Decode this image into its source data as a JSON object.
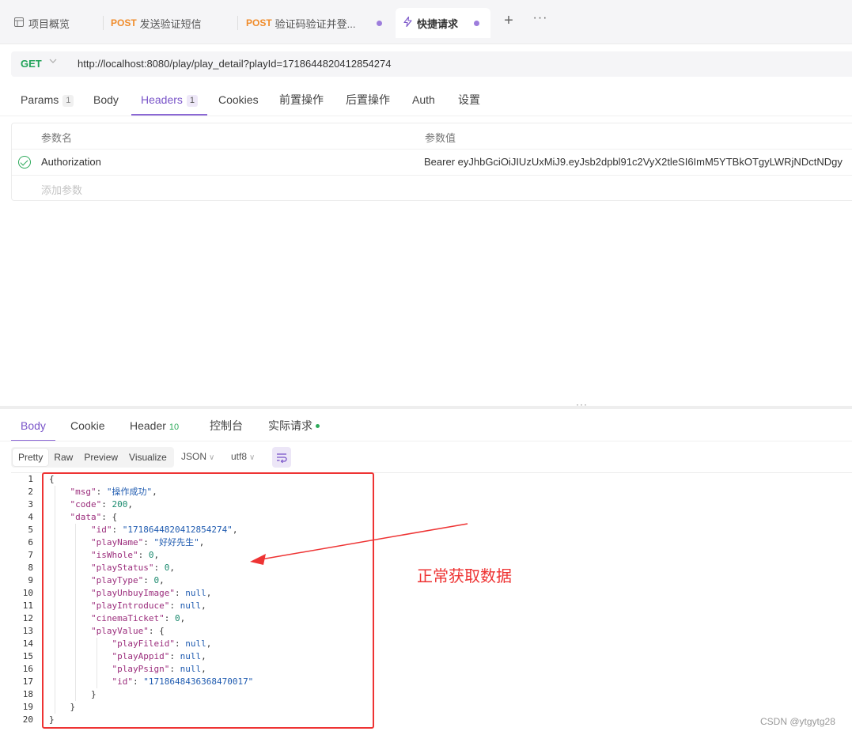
{
  "tabs": [
    {
      "method": "",
      "label": "项目概览"
    },
    {
      "method": "POST",
      "label": "发送验证短信"
    },
    {
      "method": "POST",
      "label": "验证码验证并登..."
    },
    {
      "method": "",
      "label": "快捷请求"
    }
  ],
  "tabbar_icons": {
    "plus": "+",
    "more": "···"
  },
  "request": {
    "method": "GET",
    "url": "http://localhost:8080/play/play_detail?playId=1718644820412854274"
  },
  "request_tabs": [
    {
      "label": "Params",
      "badge": "1"
    },
    {
      "label": "Body"
    },
    {
      "label": "Headers",
      "badge": "1"
    },
    {
      "label": "Cookies"
    },
    {
      "label": "前置操作"
    },
    {
      "label": "后置操作"
    },
    {
      "label": "Auth"
    },
    {
      "label": "设置"
    }
  ],
  "headers_table": {
    "col_name": "参数名",
    "col_value": "参数值",
    "rows": [
      {
        "name": "Authorization",
        "value": "Bearer eyJhbGciOiJIUzUxMiJ9.eyJsb2dpbl91c2VyX2tleSI6ImM5YTBkOTgyLWRjNDctNDgy"
      }
    ],
    "add_placeholder": "添加参数"
  },
  "splitter_handle": "···",
  "response_tabs": [
    {
      "label": "Body"
    },
    {
      "label": "Cookie"
    },
    {
      "label": "Header",
      "count": "10"
    },
    {
      "label": "控制台"
    },
    {
      "label": "实际请求"
    }
  ],
  "view_modes": [
    "Pretty",
    "Raw",
    "Preview",
    "Visualize"
  ],
  "format": "JSON",
  "encoding": "utf8",
  "code_lines": [
    "{",
    "    \"msg\": \"操作成功\",",
    "    \"code\": 200,",
    "    \"data\": {",
    "        \"id\": \"1718644820412854274\",",
    "        \"playName\": \"好好先生\",",
    "        \"isWhole\": 0,",
    "        \"playStatus\": 0,",
    "        \"playType\": 0,",
    "        \"playUnbuyImage\": null,",
    "        \"playIntroduce\": null,",
    "        \"cinemaTicket\": 0,",
    "        \"playValue\": {",
    "            \"playFileid\": null,",
    "            \"playAppid\": null,",
    "            \"playPsign\": null,",
    "            \"id\": \"1718648436368470017\"",
    "        }",
    "    }",
    "}"
  ],
  "annotation": "正常获取数据",
  "watermark": "CSDN @ytgytg28",
  "colors": {
    "accent": "#8b68d4",
    "method_get": "#23a35a",
    "method_post": "#f08c2b",
    "annotation": "#e33333"
  }
}
